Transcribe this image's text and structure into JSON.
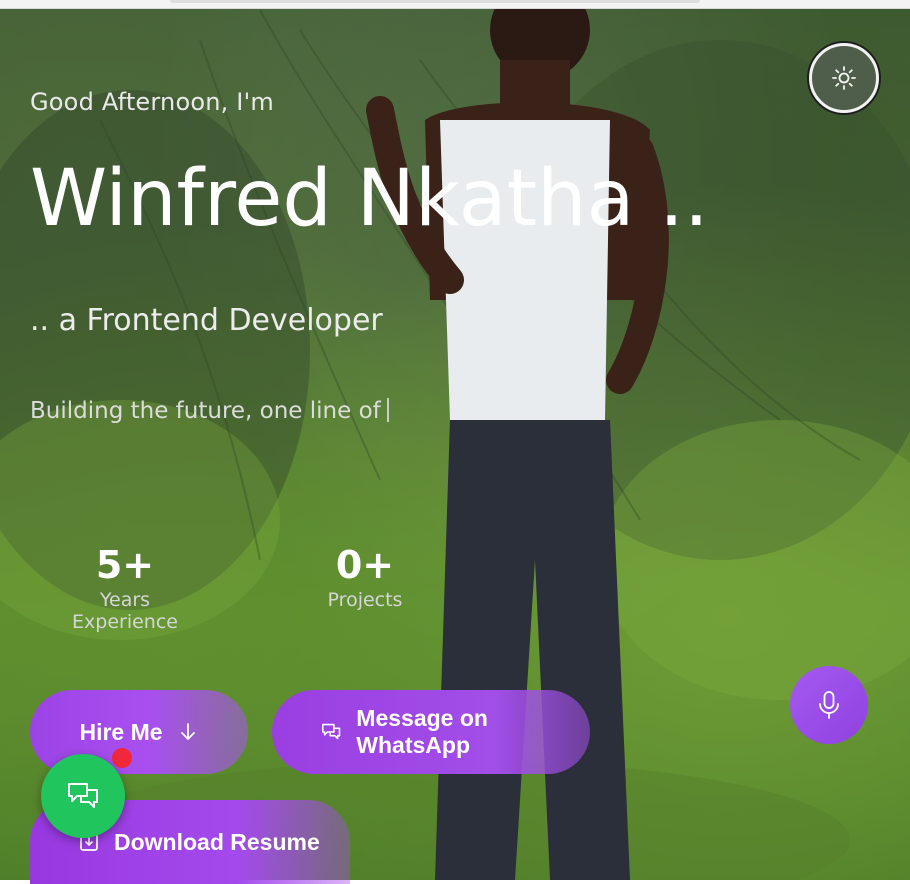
{
  "hero": {
    "greeting": "Good Afternoon, I'm",
    "name": "Winfred Nkatha ..",
    "role": ".. a Frontend Developer",
    "tagline": "Building the future, one line of"
  },
  "stats": [
    {
      "value": "5+",
      "label": "Years Experience"
    },
    {
      "value": "0+",
      "label": "Projects"
    }
  ],
  "buttons": {
    "hire": "Hire Me",
    "whatsapp": "Message on WhatsApp",
    "resume": "Download Resume"
  },
  "icons": {
    "theme": "sun-icon",
    "hire": "arrow-down-icon",
    "whatsapp": "chat-bubbles-icon",
    "resume": "download-icon",
    "mic": "microphone-icon",
    "chat_fab": "chat-bubbles-icon"
  },
  "colors": {
    "button_purple": "#9b44e6",
    "chat_fab_green": "#21c55d",
    "notification_red": "#f0283a",
    "theme_toggle_bg": "#4f5e4b"
  }
}
